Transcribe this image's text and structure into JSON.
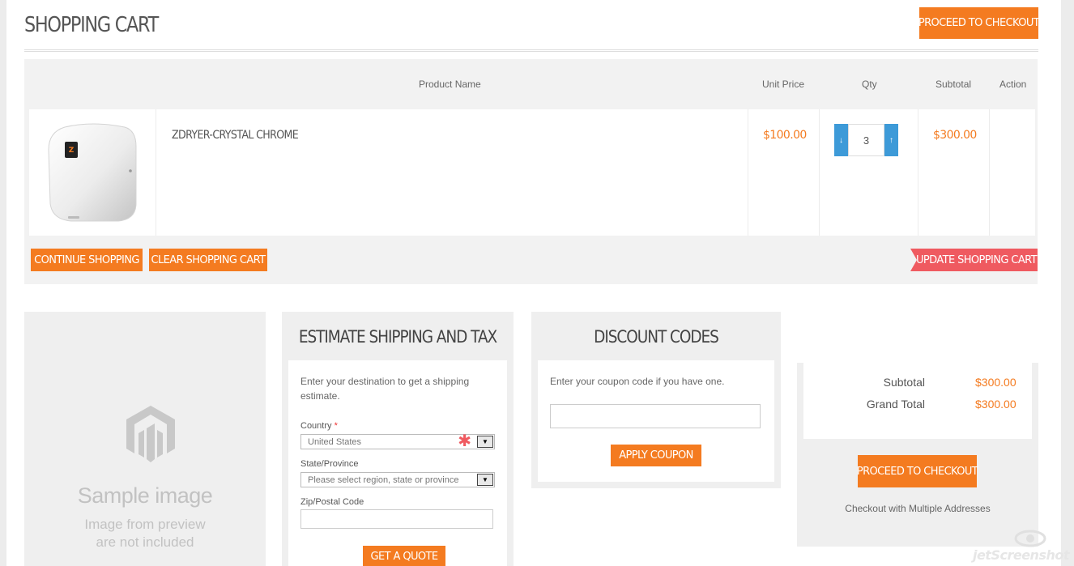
{
  "page": {
    "title": "SHOPPING CART"
  },
  "header": {
    "checkout_label": "PROCEED TO CHECKOUT"
  },
  "table": {
    "headers": {
      "product_name": "Product Name",
      "unit_price": "Unit Price",
      "qty": "Qty",
      "subtotal": "Subtotal",
      "action": "Action"
    },
    "rows": [
      {
        "name": "ZDRYER-CRYSTAL CHROME",
        "unit_price": "$100.00",
        "qty": "3",
        "subtotal": "$300.00"
      }
    ]
  },
  "actions": {
    "continue_label": "CONTINUE SHOPPING",
    "clear_label": "CLEAR SHOPPING CART",
    "update_label": "UPDATE SHOPPING CART"
  },
  "sample_image": {
    "title": "Sample image",
    "subtitle_line1": "Image from preview",
    "subtitle_line2": "are not included"
  },
  "shipping": {
    "title": "ESTIMATE SHIPPING AND TAX",
    "intro": "Enter your destination to get a shipping estimate.",
    "country_label": "Country",
    "required_mark": "*",
    "country_value": "United States",
    "state_label": "State/Province",
    "state_placeholder": "Please select region, state or province",
    "zip_label": "Zip/Postal Code",
    "zip_value": "",
    "quote_label": "GET A QUOTE"
  },
  "discount": {
    "title": "DISCOUNT CODES",
    "intro": "Enter your coupon code if you have one.",
    "coupon_value": "",
    "apply_label": "APPLY COUPON"
  },
  "totals": {
    "subtotal_label": "Subtotal",
    "subtotal_value": "$300.00",
    "grand_total_label": "Grand Total",
    "grand_total_value": "$300.00",
    "checkout_label": "PROCEED TO CHECKOUT",
    "multi_label": "Checkout with Multiple Addresses"
  },
  "icons": {
    "qty_decrease": "down-arrow-icon",
    "qty_increase": "up-arrow-icon",
    "select_arrow": "dropdown-arrow-icon",
    "placeholder": "magento-logo-icon"
  },
  "colors": {
    "accent": "#f47b20",
    "update": "#ef5a60",
    "qty_buttons": "#3d9ad8"
  },
  "watermark": {
    "text": "jetScreenshot"
  }
}
